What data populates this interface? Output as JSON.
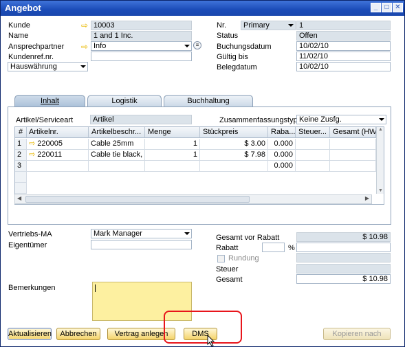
{
  "window": {
    "title": "Angebot"
  },
  "header_left": {
    "kunde_label": "Kunde",
    "kunde_value": "10003",
    "name_label": "Name",
    "name_value": "1 and 1 Inc.",
    "ansprech_label": "Ansprechpartner",
    "ansprech_value": "Info",
    "kundenref_label": "Kundenref.nr.",
    "kundenref_value": "",
    "currency_value": "Hauswährung"
  },
  "header_right": {
    "nr_label": "Nr.",
    "series_value": "Primary",
    "nr_value": "1",
    "status_label": "Status",
    "status_value": "Offen",
    "buchung_label": "Buchungsdatum",
    "buchung_value": "10/02/10",
    "gueltig_label": "Gültig bis",
    "gueltig_value": "11/02/10",
    "beleg_label": "Belegdatum",
    "beleg_value": "10/02/10"
  },
  "tabs": [
    "Inhalt",
    "Logistik",
    "Buchhaltung"
  ],
  "content": {
    "artikel_label": "Artikel/Serviceart",
    "artikel_value": "Artikel",
    "zusfas_label": "Zusammenfassungstyp",
    "zusfas_value": "Keine Zusfg."
  },
  "table": {
    "columns": [
      "#",
      "Artikelnr.",
      "Artikelbeschr...",
      "Menge",
      "Stückpreis",
      "Raba...",
      "Steuer...",
      "Gesamt (HW)"
    ],
    "rows": [
      {
        "n": "1",
        "item": "220005",
        "desc": "Cable 25mm",
        "qty": "1",
        "price": "$ 3.00",
        "disc": "0.000"
      },
      {
        "n": "2",
        "item": "220011",
        "desc": "Cable tie black, w",
        "qty": "1",
        "price": "$ 7.98",
        "disc": "0.000"
      },
      {
        "n": "3",
        "item": "",
        "desc": "",
        "qty": "",
        "price": "",
        "disc": "0.000"
      }
    ]
  },
  "footer_left": {
    "vertrieb_label": "Vertriebs-MA",
    "vertrieb_value": "Mark Manager",
    "eigentuemer_label": "Eigentümer",
    "bemerkungen_label": "Bemerkungen"
  },
  "footer_right": {
    "gesamt_vor_label": "Gesamt vor Rabatt",
    "gesamt_vor_value": "$ 10.98",
    "rabatt_label": "Rabatt",
    "pct": "%",
    "rundung_label": "Rundung",
    "steuer_label": "Steuer",
    "gesamt_label": "Gesamt",
    "gesamt_value": "$ 10.98"
  },
  "buttons": {
    "aktualisieren": "Aktualisieren",
    "abbrechen": "Abbrechen",
    "vertrag": "Vertrag anlegen",
    "dms": "DMS",
    "kopieren": "Kopieren nach"
  },
  "colors": {
    "annotation": "#e8151b",
    "link_arrow": "#e8b800"
  }
}
